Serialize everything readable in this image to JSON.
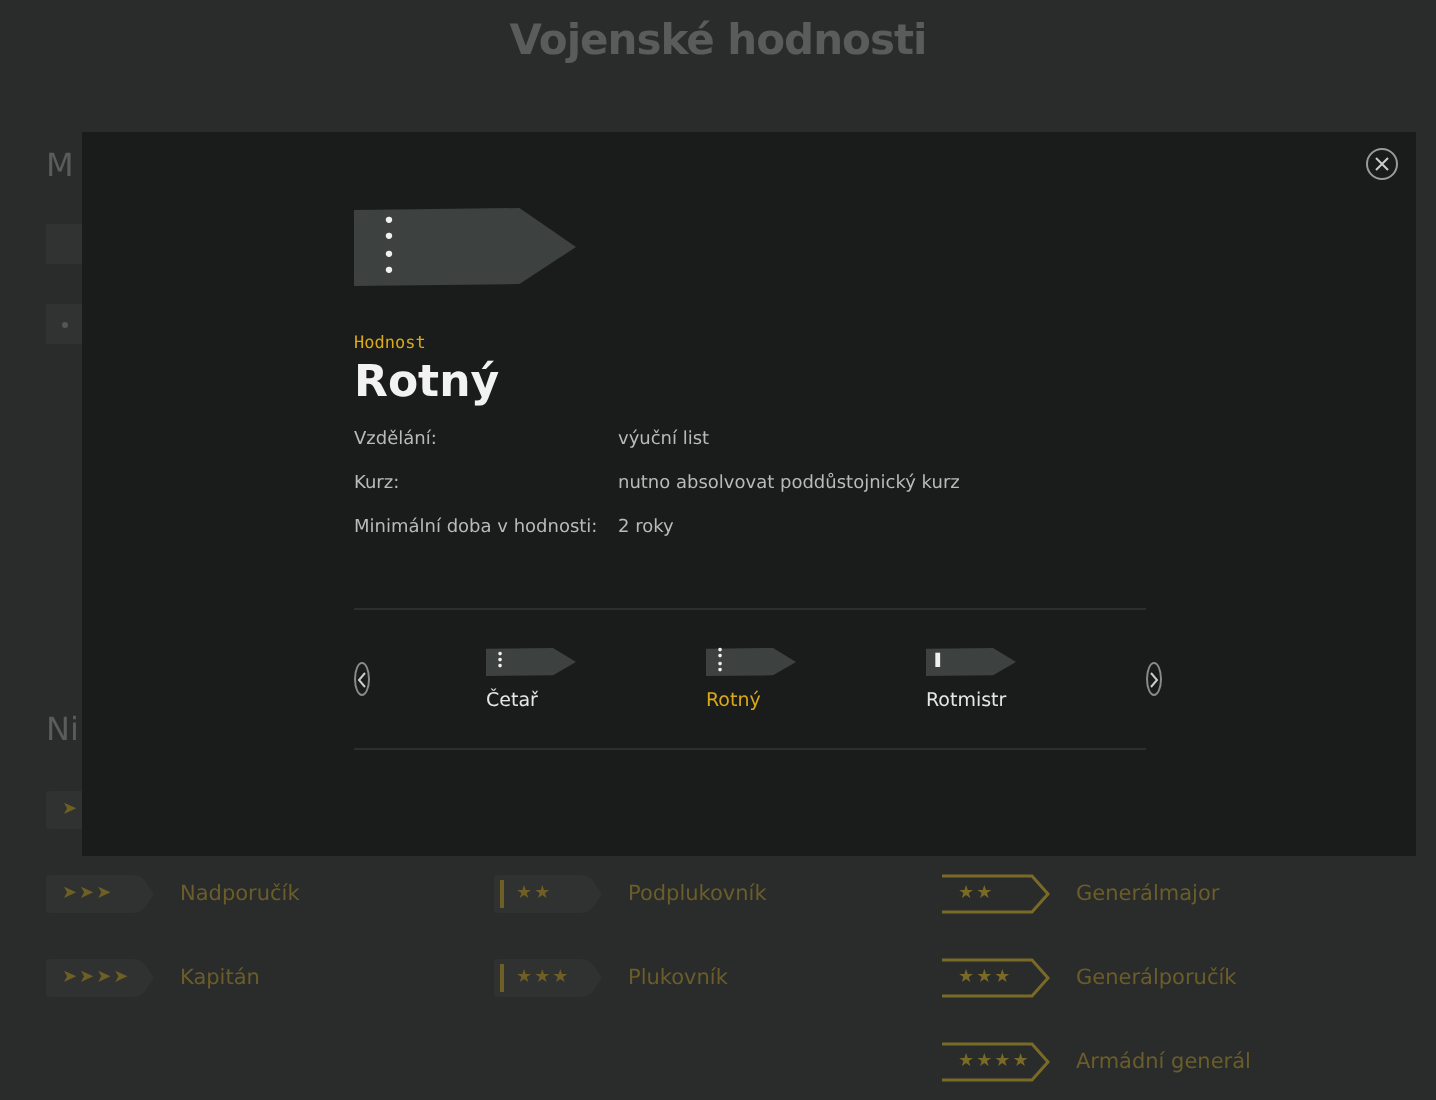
{
  "page": {
    "title": "Vojenské hodnosti",
    "sections": [
      {
        "heading": "M"
      },
      {
        "heading": "Ni"
      }
    ],
    "rank_columns": [
      {
        "items": [
          {
            "kind": "standard",
            "insignia": "➤"
          },
          {
            "kind": "standard",
            "insignia": "➤➤➤",
            "label": "Nadporučík"
          },
          {
            "kind": "standard",
            "insignia": "➤➤➤➤",
            "label": "Kapitán"
          }
        ]
      },
      {
        "items": [
          {
            "kind": "staff",
            "insignia": "★★",
            "label": "Podplukovník"
          },
          {
            "kind": "staff",
            "insignia": "★★★",
            "label": "Plukovník"
          }
        ]
      },
      {
        "items": [
          {
            "kind": "general",
            "insignia": "★★",
            "label": "Generálmajor"
          },
          {
            "kind": "general",
            "insignia": "★★★",
            "label": "Generálporučík"
          },
          {
            "kind": "general",
            "insignia": "★★★★",
            "label": "Armádní generál"
          }
        ]
      }
    ]
  },
  "dialog": {
    "insignia": "••••",
    "eyebrow": "Hodnost",
    "title": "Rotný",
    "details": [
      {
        "label": "Vzdělání:",
        "value": "výuční list"
      },
      {
        "label": "Kurz:",
        "value": "nutno absolvovat poddůstojnický kurz"
      },
      {
        "label": "Minimální doba v hodnosti:",
        "value": "2 roky"
      }
    ],
    "carousel": [
      {
        "label": "Četař",
        "insignia": "•••",
        "selected": false
      },
      {
        "label": "Rotný",
        "insignia": "••••",
        "selected": true
      },
      {
        "label": "Rotmistr",
        "insignia": "▌",
        "selected": false
      }
    ]
  }
}
